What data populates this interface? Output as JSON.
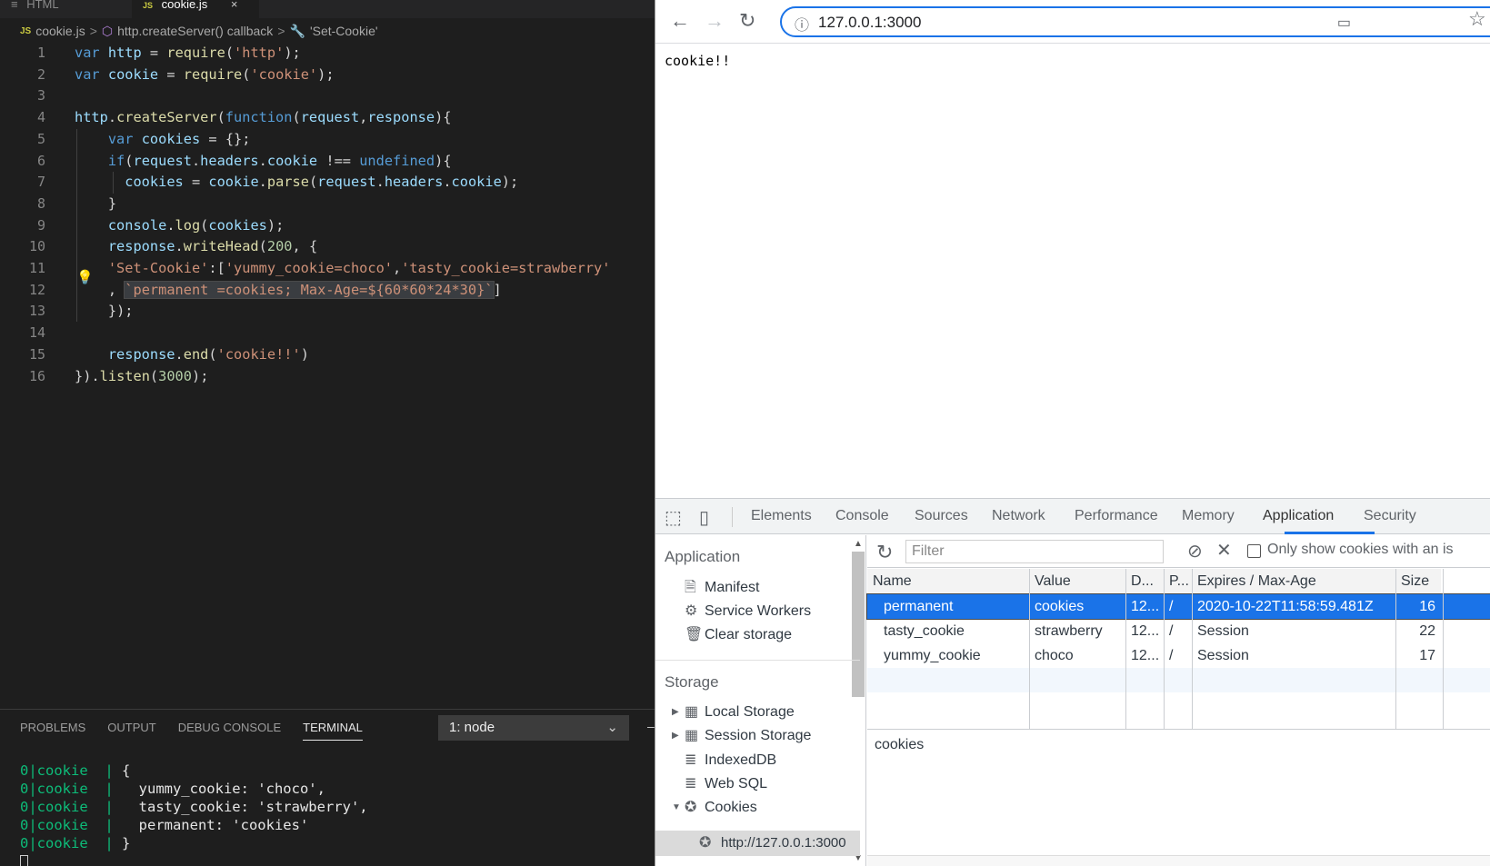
{
  "vscode": {
    "tabs": [
      {
        "label": "HTML",
        "icon": "≡"
      },
      {
        "label": "cookie.js",
        "icon": "JS",
        "close": "×"
      }
    ],
    "breadcrumb": {
      "js_badge": "JS",
      "file": "cookie.js",
      "sep": ">",
      "scope": "http.createServer() callback",
      "symbol": "'Set-Cookie'"
    },
    "line_numbers": [
      "1",
      "2",
      "3",
      "4",
      "5",
      "6",
      "7",
      "8",
      "9",
      "10",
      "11",
      "12",
      "13",
      "14",
      "15",
      "16"
    ],
    "code_lines": [
      "var http = require('http');",
      "var cookie = require('cookie');",
      "",
      "http.createServer(function(request,response){",
      "    var cookies = {};",
      "    if(request.headers.cookie !== undefined){",
      "      cookies = cookie.parse(request.headers.cookie);",
      "    }",
      "    console.log(cookies);",
      "    response.writeHead(200, {",
      "    'Set-Cookie':['yummy_cookie=choco','tasty_cookie=strawberry'",
      "    , `permanent =cookies; Max-Age=${60*60*24*30}`]",
      "    });",
      "",
      "    response.end('cookie!!')",
      "}).listen(3000);"
    ],
    "panel": {
      "tabs": [
        "PROBLEMS",
        "OUTPUT",
        "DEBUG CONSOLE",
        "TERMINAL"
      ],
      "active_tab": "TERMINAL",
      "terminal_select": "1: node",
      "terminal_prefix": "0|cookie  |",
      "terminal_lines": [
        " {",
        "   yummy_cookie: 'choco',",
        "   tasty_cookie: 'strawberry',",
        "   permanent: 'cookies'",
        " }"
      ]
    }
  },
  "browser": {
    "url": "127.0.0.1:3000",
    "page_text": "cookie!!",
    "devtools": {
      "tabs": [
        "Elements",
        "Console",
        "Sources",
        "Network",
        "Performance",
        "Memory",
        "Application",
        "Security"
      ],
      "active_tab": "Application",
      "sidebar": {
        "application_header": "Application",
        "application_items": [
          "Manifest",
          "Service Workers",
          "Clear storage"
        ],
        "storage_header": "Storage",
        "storage_items": [
          "Local Storage",
          "Session Storage",
          "IndexedDB",
          "Web SQL",
          "Cookies"
        ],
        "cookie_origin": "http://127.0.0.1:3000"
      },
      "toolbar": {
        "filter_placeholder": "Filter",
        "only_show_label": "Only show cookies with an is"
      },
      "table": {
        "headers": [
          "Name",
          "Value",
          "D...",
          "P...",
          "Expires / Max-Age",
          "Size"
        ],
        "rows": [
          {
            "name": "permanent",
            "value": "cookies",
            "domain": "12...",
            "path": "/",
            "expires": "2020-10-22T11:58:59.481Z",
            "size": "16"
          },
          {
            "name": "tasty_cookie",
            "value": "strawberry",
            "domain": "12...",
            "path": "/",
            "expires": "Session",
            "size": "22"
          },
          {
            "name": "yummy_cookie",
            "value": "choco",
            "domain": "12...",
            "path": "/",
            "expires": "Session",
            "size": "17"
          }
        ],
        "selected_row": 0
      },
      "value_preview": "cookies"
    }
  },
  "colors": {
    "accent": "#1a73e8",
    "editor_bg": "#1e1e1e",
    "string": "#ce9178",
    "keyword": "#569cd6",
    "terminal_green": "#0dbc79"
  }
}
